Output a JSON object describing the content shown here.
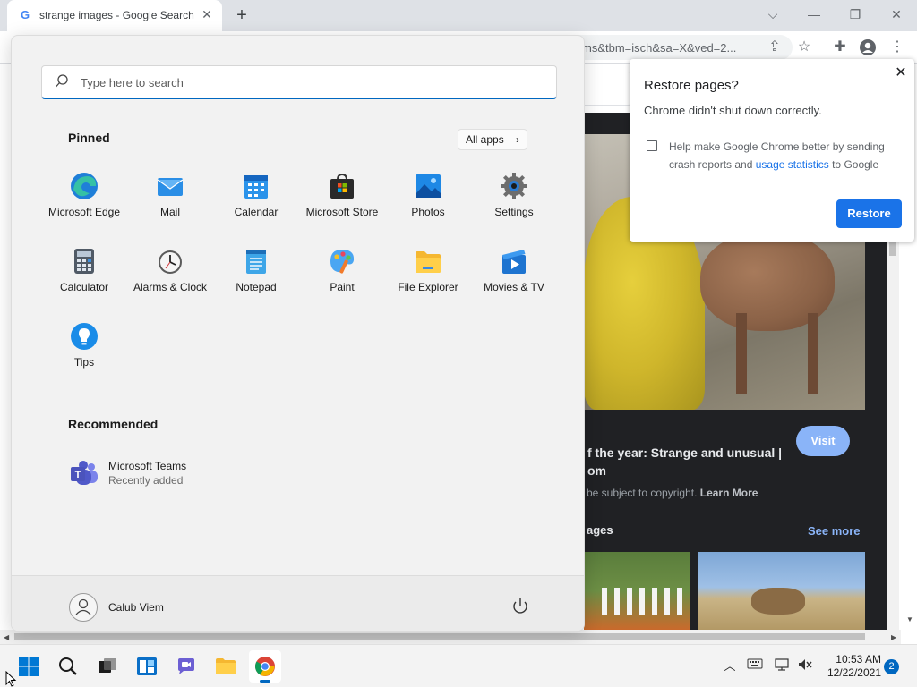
{
  "browser": {
    "tab_title": "strange images - Google Search",
    "tab_favicon": "G",
    "url": "ms&tbm=isch&sa=X&ved=2..."
  },
  "page": {
    "result_title": "f the year: Strange and unusual | om",
    "visit_label": "Visit",
    "copyright_text": "be subject to copyright.",
    "learn_more": "Learn More",
    "related_label": "ages",
    "see_more": "See more"
  },
  "restore_dialog": {
    "title": "Restore pages?",
    "message": "Chrome didn't shut down correctly.",
    "checkbox_text_before": "Help make Google Chrome better by sending crash reports and ",
    "checkbox_link": "usage statistics",
    "checkbox_text_after": " to Google",
    "restore_button": "Restore"
  },
  "start_menu": {
    "search_placeholder": "Type here to search",
    "pinned_heading": "Pinned",
    "all_apps_label": "All apps",
    "pinned": [
      {
        "label": "Microsoft Edge",
        "icon": "edge-icon"
      },
      {
        "label": "Mail",
        "icon": "mail-icon"
      },
      {
        "label": "Calendar",
        "icon": "calendar-icon"
      },
      {
        "label": "Microsoft Store",
        "icon": "store-icon"
      },
      {
        "label": "Photos",
        "icon": "photos-icon"
      },
      {
        "label": "Settings",
        "icon": "settings-icon"
      },
      {
        "label": "Calculator",
        "icon": "calculator-icon"
      },
      {
        "label": "Alarms & Clock",
        "icon": "clock-icon"
      },
      {
        "label": "Notepad",
        "icon": "notepad-icon"
      },
      {
        "label": "Paint",
        "icon": "paint-icon"
      },
      {
        "label": "File Explorer",
        "icon": "folder-icon"
      },
      {
        "label": "Movies & TV",
        "icon": "movies-icon"
      },
      {
        "label": "Tips",
        "icon": "tips-icon"
      }
    ],
    "recommended_heading": "Recommended",
    "recommended": [
      {
        "name": "Microsoft Teams",
        "subtitle": "Recently added",
        "icon": "teams-icon"
      }
    ],
    "user_name": "Calub Viem"
  },
  "taskbar": {
    "time": "10:53 AM",
    "date": "12/22/2021",
    "notification_count": "2"
  },
  "colors": {
    "accent": "#0067c0",
    "chrome_blue": "#1a73e8"
  }
}
